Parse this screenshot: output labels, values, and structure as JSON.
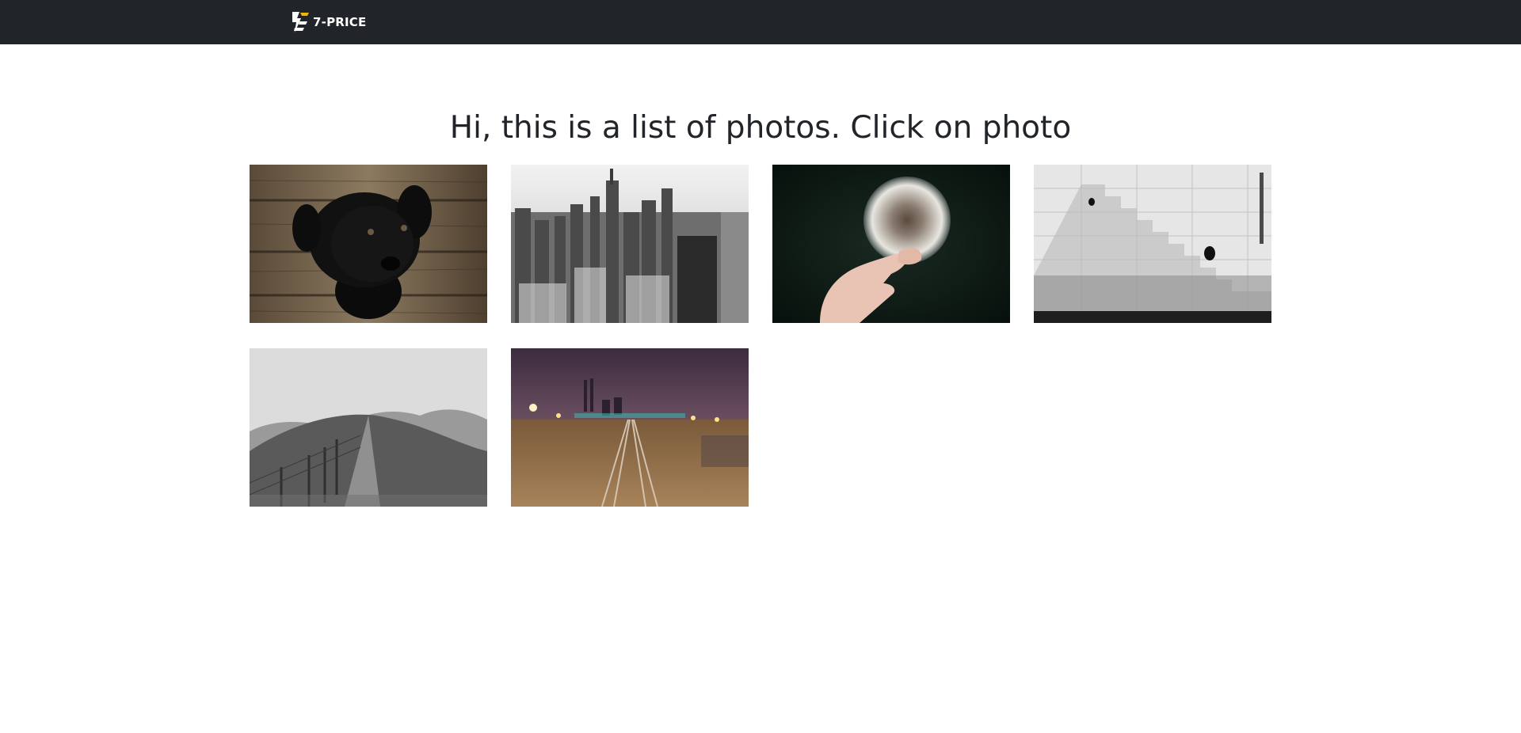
{
  "navbar": {
    "brand_text": "7-PRICE",
    "logo_icon": "lightning-s-logo-icon",
    "colors": {
      "background": "#212529",
      "logo_accent": "#f2b705"
    }
  },
  "main": {
    "heading": "Hi, this is a list of photos. Click on photo"
  },
  "photos": [
    {
      "subject": "black-puppy-on-wooden-floor"
    },
    {
      "subject": "city-skyline-black-and-white"
    },
    {
      "subject": "hand-holding-dandelion"
    },
    {
      "subject": "stone-stairs-wall-black-and-white"
    },
    {
      "subject": "hill-path-with-fence-black-and-white"
    },
    {
      "subject": "railway-tracks-at-night"
    }
  ]
}
